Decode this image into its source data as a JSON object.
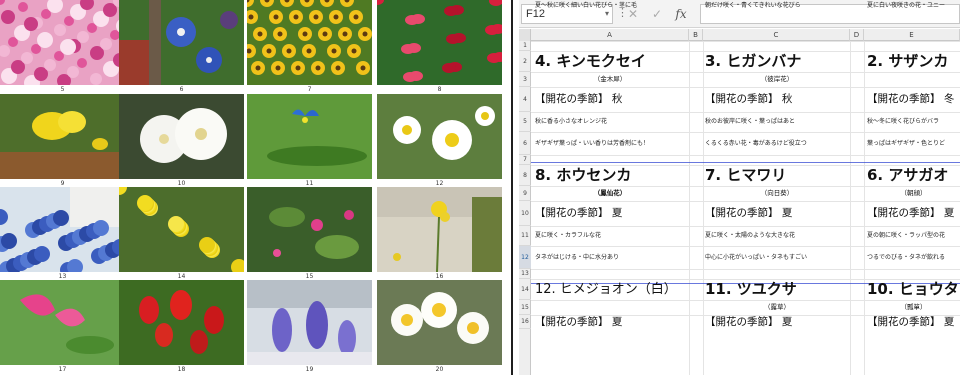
{
  "left_panel": {
    "photos": [
      {
        "num": "5",
        "subject": "pink cosmos field"
      },
      {
        "num": "6",
        "subject": "blue morning glory"
      },
      {
        "num": "7",
        "subject": "sunflower field"
      },
      {
        "num": "8",
        "subject": "red impatiens"
      },
      {
        "num": "9",
        "subject": "yellow flower on wood"
      },
      {
        "num": "10",
        "subject": "white hollyhock"
      },
      {
        "num": "11",
        "subject": "blue dayflower"
      },
      {
        "num": "12",
        "subject": "white daisy fleabane"
      },
      {
        "num": "13",
        "subject": "blue hydrangea"
      },
      {
        "num": "14",
        "subject": "yellow evening primrose"
      },
      {
        "num": "15",
        "subject": "pink four o'clock"
      },
      {
        "num": "16",
        "subject": "yellow rapeseed"
      },
      {
        "num": "17",
        "subject": "pink sweet pea"
      },
      {
        "num": "18",
        "subject": "red tulips"
      },
      {
        "num": "19",
        "subject": "purple hyacinth"
      },
      {
        "num": "20",
        "subject": "white narcissus"
      }
    ]
  },
  "formula_bar": {
    "name_box": "F12",
    "cancel_icon": "✕",
    "enter_icon": "✓",
    "fx_label": "fx"
  },
  "columns": [
    "A",
    "B",
    "C",
    "D",
    "E"
  ],
  "rows": [
    "1",
    "2",
    "3",
    "4",
    "5",
    "6",
    "7",
    "8",
    "9",
    "10",
    "11",
    "12",
    "13",
    "14",
    "15",
    "16"
  ],
  "selected_row": "12",
  "cards": [
    {
      "title": "4. キンモクセイ",
      "sub": "（金木犀）",
      "season": "【開花の季節】 秋",
      "d1": "秋に香る小さなオレンジ花",
      "d2": "ギザギザ葉っぱ・いい香りは芳香剤にも！"
    },
    {
      "title": "3. ヒガンバナ",
      "sub": "（彼岸花）",
      "season": "【開花の季節】 秋",
      "d1": "秋のお彼岸に咲く・葉っぱはあと",
      "d2": "くるくる赤い花・毒があるけど役立つ"
    },
    {
      "title": "2. サザンカ",
      "sub": "",
      "season": "【開花の季節】 冬",
      "d1": "秋〜冬に咲く花びらがバラ",
      "d2": "葉っぱはギザギザ・色とりど"
    },
    {
      "title": "8. ホウセンカ",
      "sub": "（鳳仙花）",
      "season": "【開花の季節】 夏",
      "d1": "夏に咲く・カラフルな花",
      "d2": "タネがはじける・中に水分あり"
    },
    {
      "title": "7. ヒマワリ",
      "sub": "（向日葵）",
      "season": "【開花の季節】 夏",
      "d1": "夏に咲く・太陽のような大きな花",
      "d2": "中心に小花がいっぱい・タネもすごい"
    },
    {
      "title": "6. アサガオ",
      "sub": "（朝顔）",
      "season": "【開花の季節】 夏",
      "d1": "夏の朝に咲く・ラッパ型の花",
      "d2": "つるでのびる・タネが飲れる"
    },
    {
      "title": "12. ヒメジョオン（白）",
      "sub": "",
      "season": "【開花の季節】 夏",
      "d1": "夏〜秋に咲く細い白い花びら・茎に毛",
      "d2": ""
    },
    {
      "title": "11. ツユクサ",
      "sub": "（露草）",
      "season": "【開花の季節】 夏",
      "d1": "朝だけ咲く・青くてきれいな花びら",
      "d2": ""
    },
    {
      "title": "10. ヒョウタ",
      "sub": "（瓢箪）",
      "season": "【開花の季節】 夏",
      "d1": "夏に白い夜咲きの花・ユニー",
      "d2": ""
    }
  ]
}
